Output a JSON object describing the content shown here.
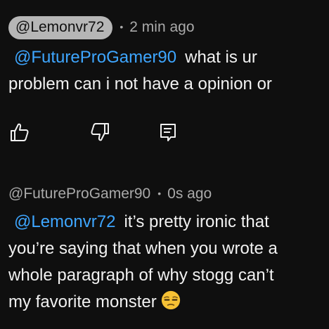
{
  "comments": [
    {
      "author": "@Lemonvr72",
      "separator": "•",
      "time": "2 min ago",
      "mention": "@FutureProGamer90",
      "lines": [
        "what is ur",
        "problem can i not have a opinion or"
      ]
    },
    {
      "author": "@FutureProGamer90",
      "separator": "•",
      "time": "0s ago",
      "mention": "@Lemonvr72",
      "lines": [
        "it’s pretty ironic that",
        "you’re saying that when you wrote a",
        "whole paragraph of why stogg can’t",
        "my favorite monster"
      ],
      "emoji": "unamused-face"
    }
  ],
  "actions": {
    "like_icon": "thumbs-up-icon",
    "dislike_icon": "thumbs-down-icon",
    "reply_icon": "reply-icon"
  },
  "colors": {
    "background": "#0f0f0f",
    "text": "#f1f1f1",
    "muted": "#aaaaaa",
    "mention": "#3ea6ff",
    "author_chip": "#b6b6b6"
  }
}
